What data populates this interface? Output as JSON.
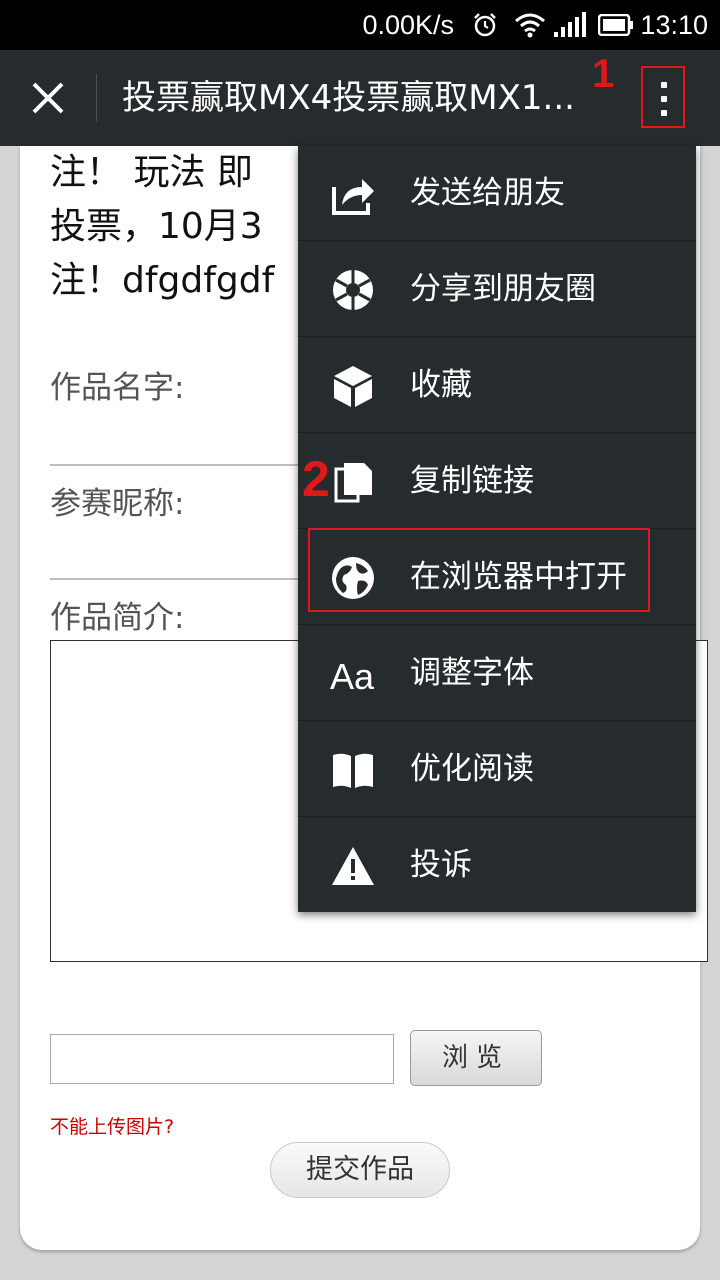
{
  "status_bar": {
    "speed": "0.00K/s",
    "time": "13:10",
    "icons": [
      "alarm-icon",
      "wifi-icon",
      "signal-icon",
      "battery-icon"
    ]
  },
  "toolbar": {
    "title": "投票赢取MX4投票赢取MX1...",
    "close_icon": "close-icon",
    "more_icon": "more-vertical-icon"
  },
  "annotations": {
    "marker_1": "1",
    "marker_2": "2",
    "highlight_color": "#e01818"
  },
  "page": {
    "intro_lines": [
      "注！ 玩法 即",
      "投票，10月3",
      "注！dfgdfgdf"
    ],
    "work_name_label": "作品名字:",
    "nickname_label": "参赛昵称:",
    "intro_label": "作品简介:",
    "browse_button": "浏览",
    "upload_hint": "不能上传图片?",
    "submit_button": "提交作品"
  },
  "menu": {
    "items": [
      {
        "label": "发送给朋友",
        "icon": "share-arrow-icon"
      },
      {
        "label": "分享到朋友圈",
        "icon": "aperture-icon"
      },
      {
        "label": "收藏",
        "icon": "cube-icon"
      },
      {
        "label": "复制链接",
        "icon": "copy-icon"
      },
      {
        "label": "在浏览器中打开",
        "icon": "globe-icon"
      },
      {
        "label": "调整字体",
        "icon": "font-size-icon"
      },
      {
        "label": "优化阅读",
        "icon": "book-icon"
      },
      {
        "label": "投诉",
        "icon": "warning-icon"
      }
    ]
  }
}
